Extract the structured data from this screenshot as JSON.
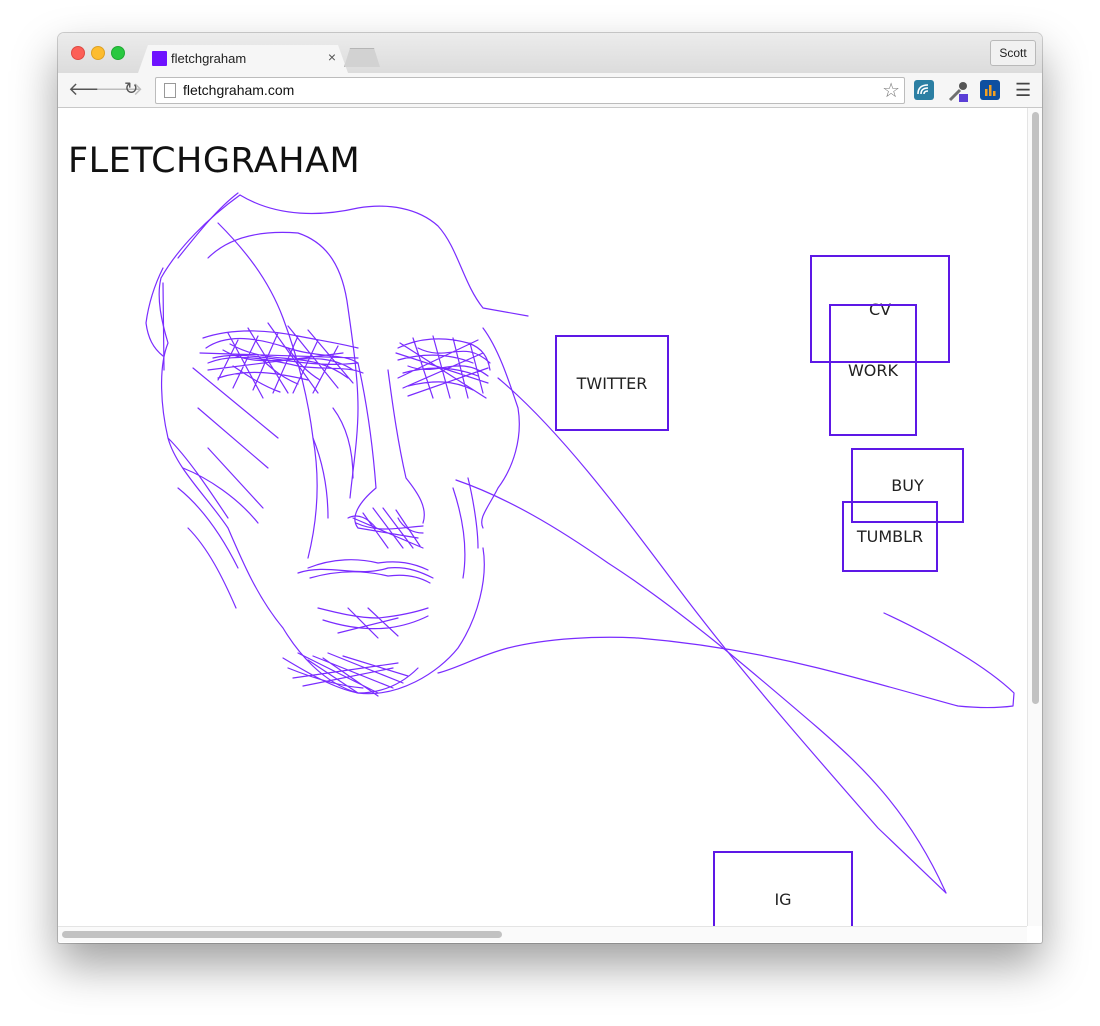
{
  "browser": {
    "tab_title": "fletchgraham",
    "tab_close": "×",
    "profile": "Scott",
    "url": "fletchgraham.com",
    "icons": [
      "back-arrow-icon",
      "forward-arrow-icon",
      "reload-icon",
      "page-icon",
      "star-icon",
      "extension-icon",
      "eyedropper-icon",
      "analytics-icon",
      "menu-icon"
    ]
  },
  "page": {
    "title": "FLETCHGRAHAM",
    "links": {
      "cv": "CV",
      "work": "WORK",
      "twitter": "TWITTER",
      "buy": "BUY",
      "tumblr": "TUMBLR",
      "ig": "IG"
    },
    "accent_color": "#5d18e6",
    "drawing_color": "#7a2cff"
  }
}
